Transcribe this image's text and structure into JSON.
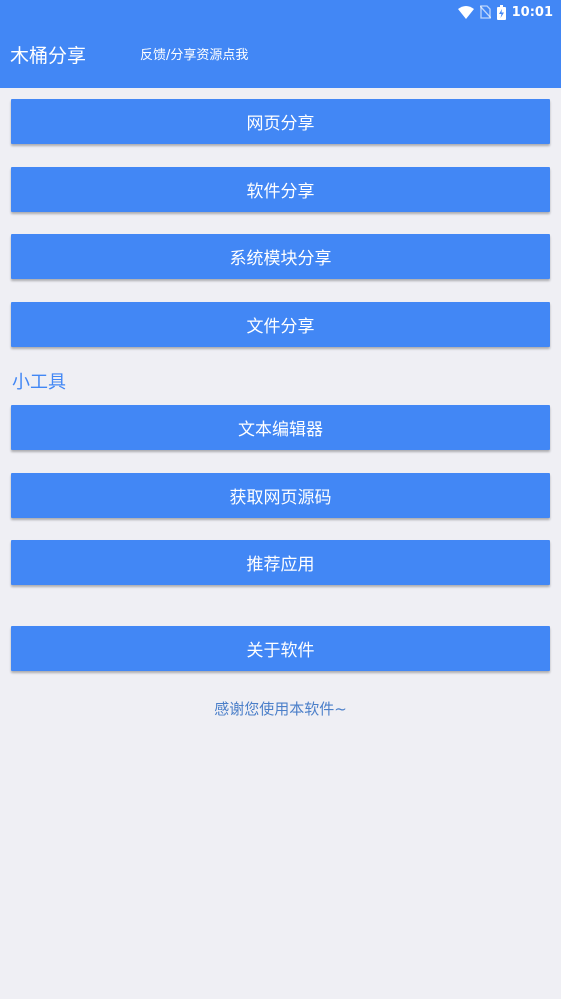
{
  "status_bar": {
    "time": "10:01",
    "icons": [
      "wifi-icon",
      "no-sim-icon",
      "battery-charging-icon"
    ]
  },
  "app_bar": {
    "title": "木桶分享",
    "feedback_link": "反馈/分享资源点我"
  },
  "share_buttons": [
    {
      "label": "网页分享"
    },
    {
      "label": "软件分享"
    },
    {
      "label": "系统模块分享"
    },
    {
      "label": "文件分享"
    }
  ],
  "tools_section": {
    "title": "小工具",
    "buttons": [
      {
        "label": "文本编辑器"
      },
      {
        "label": "获取网页源码"
      },
      {
        "label": "推荐应用"
      }
    ]
  },
  "about_button": {
    "label": "关于软件"
  },
  "footer": {
    "thanks_text": "感谢您使用本软件~"
  },
  "colors": {
    "primary": "#4287f5",
    "background": "#efeff4",
    "footer_text": "#4b7fc9"
  }
}
